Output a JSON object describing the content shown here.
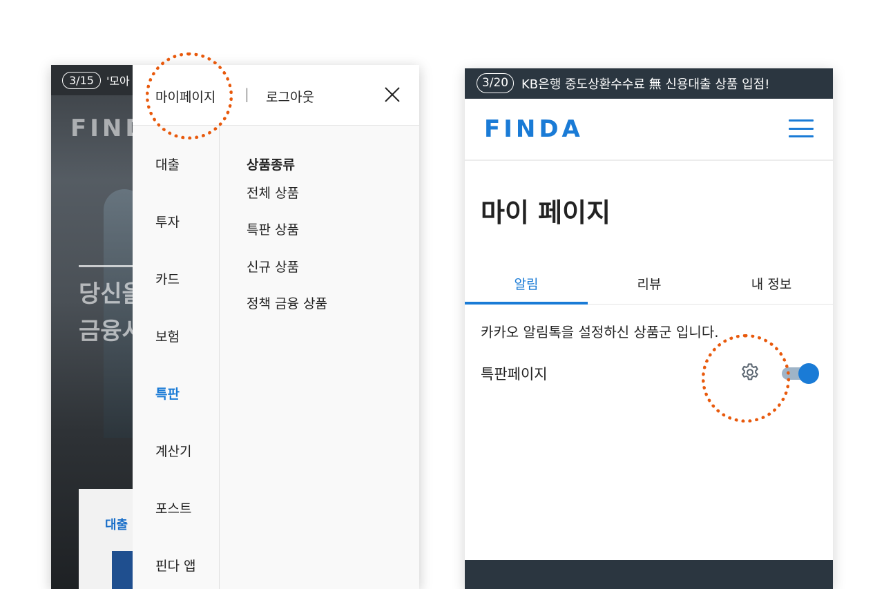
{
  "left_phone": {
    "background": {
      "notice_badge": "3/15",
      "notice_text": "'모아",
      "logo": "FIND",
      "hero_text": [
        "당신을",
        "금융시"
      ],
      "card_label": "대출"
    },
    "menu": {
      "header": {
        "mypage": "마이페이지",
        "separator": "|",
        "logout": "로그아웃"
      },
      "categories": [
        {
          "label": "대출",
          "active": false
        },
        {
          "label": "투자",
          "active": false
        },
        {
          "label": "카드",
          "active": false
        },
        {
          "label": "보험",
          "active": false
        },
        {
          "label": "특판",
          "active": true
        },
        {
          "label": "계산기",
          "active": false
        },
        {
          "label": "포스트",
          "active": false
        },
        {
          "label": "핀다 앱",
          "active": false
        }
      ],
      "submenu": {
        "heading": "상품종류",
        "items": [
          "전체 상품",
          "특판 상품",
          "신규 상품",
          "정책 금융 상품"
        ]
      }
    }
  },
  "right_phone": {
    "notice_badge": "3/20",
    "notice_text": "KB은행 중도상환수수료 無 신용대출 상품 입점!",
    "logo": "FINDA",
    "page_title": "마이 페이지",
    "tabs": [
      {
        "label": "알림",
        "active": true
      },
      {
        "label": "리뷰",
        "active": false
      },
      {
        "label": "내 정보",
        "active": false
      }
    ],
    "description": "카카오 알림톡을 설정하신 상품군 입니다.",
    "setting_row": {
      "label": "특판페이지",
      "toggle_on": true
    }
  },
  "colors": {
    "brand_blue": "#1a7bd6",
    "annotation_orange": "#e8590c",
    "dark_bar": "#2b3640"
  }
}
